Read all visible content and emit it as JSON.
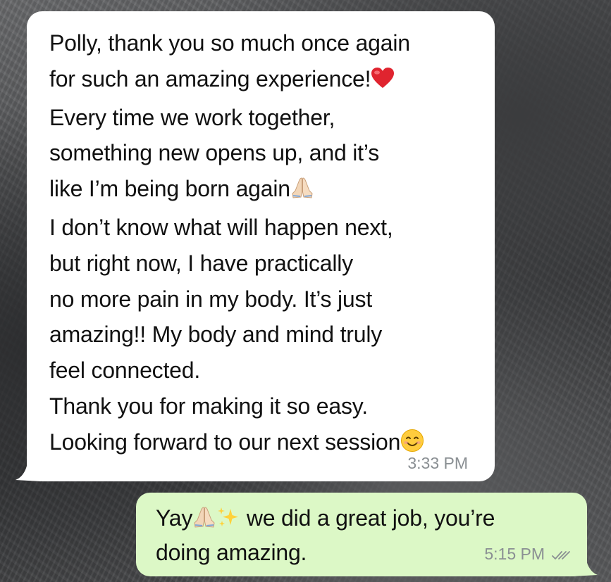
{
  "chat": {
    "incoming": {
      "lines": [
        "Polly, thank you so much once again",
        "for such an amazing experience!",
        "Every time we work together,",
        "something new opens up, and it’s",
        "like I’m being born again",
        "I don’t know what will happen next,",
        "but right now, I have practically",
        "no more pain in my body. It’s just",
        "amazing!! My body and mind truly",
        "feel connected.",
        "Thank you for making it so easy.",
        "Looking forward to our next session"
      ],
      "time": "3:33 PM",
      "emojis": {
        "line2": "red-heart-icon",
        "line5": "folded-hands-icon",
        "line12": "smiling-face-icon"
      }
    },
    "outgoing": {
      "line1_a": "Yay",
      "line1_b": " we did a great job, you’re",
      "line2": "doing amazing.",
      "time": "5:15 PM",
      "emojis": [
        "folded-hands-icon",
        "sparkles-icon"
      ],
      "status": "read-ticks-icon"
    },
    "colors": {
      "incoming_bubble": "#ffffff",
      "outgoing_bubble": "#dcf8c6",
      "timestamp": "#8a8f93"
    }
  }
}
